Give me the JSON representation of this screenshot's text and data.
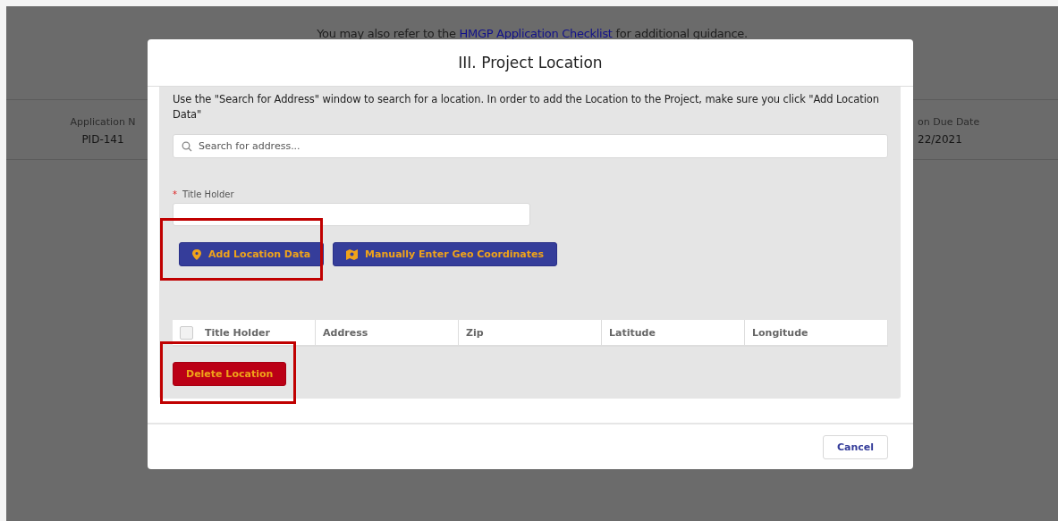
{
  "page": {
    "guidance": {
      "before": "You may also refer to the ",
      "link": "HMGP Application Checklist",
      "after": " for additional guidance."
    },
    "left_field": {
      "label": "Application N",
      "value": "PID-141"
    },
    "right_field": {
      "label": "on Due Date",
      "value": "22/2021"
    }
  },
  "modal": {
    "title": "III. Project Location",
    "instructions": "Use the \"Search for Address\" window to search for a location. In order to add the Location to the Project, make sure you click \"Add Location Data\"",
    "search": {
      "placeholder": "Search for address..."
    },
    "title_holder": {
      "label": "Title Holder",
      "required_mark": "*"
    },
    "buttons": [
      {
        "label": "Add Location Data",
        "kind": "pin",
        "highlighted": true
      },
      {
        "label": "Manually Enter Geo Coordinates",
        "kind": "map",
        "highlighted": false
      }
    ],
    "table": {
      "select_all_checked": false,
      "columns": [
        "Title Holder",
        "Address",
        "Zip",
        "Latitude",
        "Longitude"
      ]
    },
    "delete_button": {
      "label": "Delete Location",
      "highlighted": true
    },
    "footer": {
      "cancel": "Cancel"
    }
  }
}
